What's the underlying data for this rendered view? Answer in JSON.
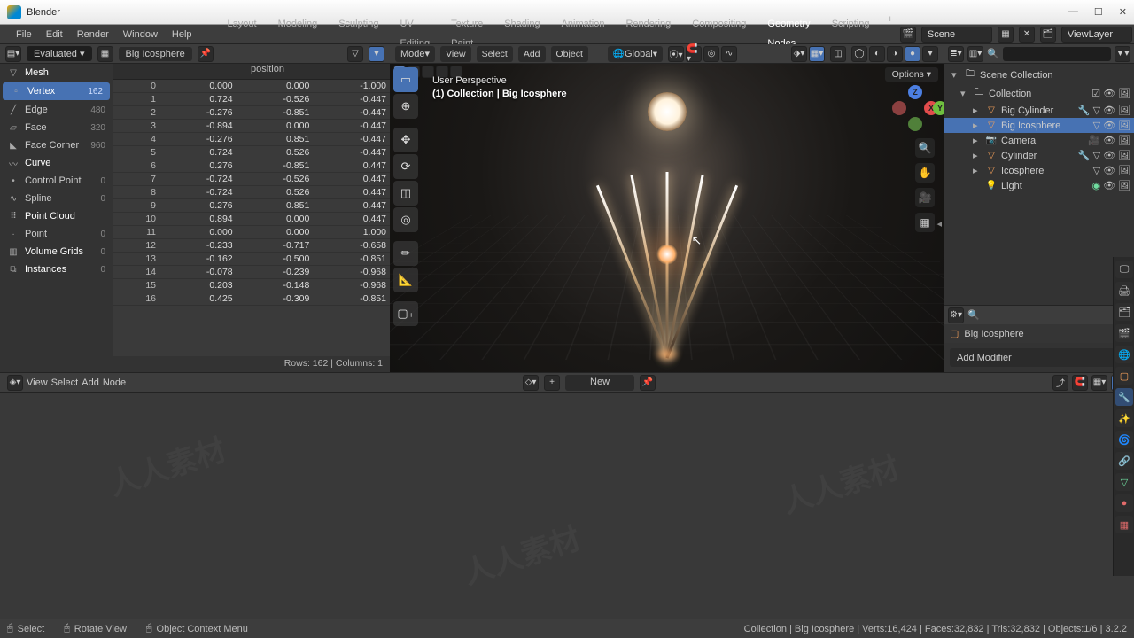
{
  "titlebar": {
    "app": "Blender"
  },
  "menu": {
    "file": "File",
    "edit": "Edit",
    "render": "Render",
    "window": "Window",
    "help": "Help"
  },
  "workspaces": {
    "layout": "Layout",
    "modeling": "Modeling",
    "sculpting": "Sculpting",
    "uv": "UV Editing",
    "texpaint": "Texture Paint",
    "shading": "Shading",
    "animation": "Animation",
    "rendering": "Rendering",
    "compositing": "Compositing",
    "geonodes": "Geometry Nodes",
    "scripting": "Scripting"
  },
  "scenebox": {
    "scene": "Scene",
    "viewlayer": "ViewLayer"
  },
  "spreadsheet": {
    "eval": "Evaluated",
    "pinned": "Big Icosphere",
    "domains": {
      "mesh": "Mesh",
      "vertex": "Vertex",
      "vertex_cnt": "162",
      "edge": "Edge",
      "edge_cnt": "480",
      "face": "Face",
      "face_cnt": "320",
      "facecorner": "Face Corner",
      "facecorner_cnt": "960",
      "curve": "Curve",
      "cp": "Control Point",
      "cp_cnt": "0",
      "spline": "Spline",
      "spline_cnt": "0",
      "pointcloud": "Point Cloud",
      "point": "Point",
      "point_cnt": "0",
      "volgrids": "Volume Grids",
      "volgrids_cnt": "0",
      "instances": "Instances",
      "instances_cnt": "0"
    },
    "col_header": "position",
    "rows": [
      {
        "i": 0,
        "x": "0.000",
        "y": "0.000",
        "z": "-1.000"
      },
      {
        "i": 1,
        "x": "0.724",
        "y": "-0.526",
        "z": "-0.447"
      },
      {
        "i": 2,
        "x": "-0.276",
        "y": "-0.851",
        "z": "-0.447"
      },
      {
        "i": 3,
        "x": "-0.894",
        "y": "0.000",
        "z": "-0.447"
      },
      {
        "i": 4,
        "x": "-0.276",
        "y": "0.851",
        "z": "-0.447"
      },
      {
        "i": 5,
        "x": "0.724",
        "y": "0.526",
        "z": "-0.447"
      },
      {
        "i": 6,
        "x": "0.276",
        "y": "-0.851",
        "z": "0.447"
      },
      {
        "i": 7,
        "x": "-0.724",
        "y": "-0.526",
        "z": "0.447"
      },
      {
        "i": 8,
        "x": "-0.724",
        "y": "0.526",
        "z": "0.447"
      },
      {
        "i": 9,
        "x": "0.276",
        "y": "0.851",
        "z": "0.447"
      },
      {
        "i": 10,
        "x": "0.894",
        "y": "0.000",
        "z": "0.447"
      },
      {
        "i": 11,
        "x": "0.000",
        "y": "0.000",
        "z": "1.000"
      },
      {
        "i": 12,
        "x": "-0.233",
        "y": "-0.717",
        "z": "-0.658"
      },
      {
        "i": 13,
        "x": "-0.162",
        "y": "-0.500",
        "z": "-0.851"
      },
      {
        "i": 14,
        "x": "-0.078",
        "y": "-0.239",
        "z": "-0.968"
      },
      {
        "i": 15,
        "x": "0.203",
        "y": "-0.148",
        "z": "-0.968"
      },
      {
        "i": 16,
        "x": "0.425",
        "y": "-0.309",
        "z": "-0.851"
      }
    ],
    "footer": "Rows: 162   |   Columns: 1"
  },
  "vp": {
    "mode": "Mode",
    "view": "View",
    "select": "Select",
    "add": "Add",
    "object": "Object",
    "orient": "Global",
    "options": "Options ▾",
    "hud1": "User Perspective",
    "hud2": "(1) Collection | Big Icosphere"
  },
  "outliner": {
    "root": "Scene Collection",
    "collection": "Collection",
    "bigcyl": "Big Cylinder",
    "bigico": "Big Icosphere",
    "camera": "Camera",
    "cylinder": "Cylinder",
    "icosphere": "Icosphere",
    "light": "Light"
  },
  "props": {
    "active": "Big Icosphere",
    "addmod": "Add Modifier"
  },
  "nodeeditor": {
    "view": "View",
    "select": "Select",
    "add": "Add",
    "node": "Node",
    "new": "New"
  },
  "status": {
    "select": "Select",
    "rotate": "Rotate View",
    "ctx": "Object Context Menu",
    "right": "Collection | Big Icosphere   |  Verts:16,424  |  Faces:32,832  |  Tris:32,832  |  Objects:1/6  |  3.2.2"
  },
  "icons": {
    "close": "✕",
    "min": "—",
    "max": "☐",
    "search": "🔍",
    "dd": "▾",
    "tri_r": "▸",
    "tri_d": "▾",
    "eye": "👁",
    "cam": "📷",
    "rndr": "🖼",
    "sel": "⌄",
    "mesh": "▽",
    "light": "💡",
    "coll": "📁",
    "pin": "📌",
    "cursor": "⊕",
    "move": "✥",
    "rot": "⟳",
    "scale": "◫",
    "xform": "◎",
    "meas": "📐",
    "anno": "✏",
    "zoom": "🔍",
    "hand": "✋",
    "persp": "▦",
    "camv": "🎥",
    "shade1": "◯",
    "shade2": "◐",
    "shade3": "◑",
    "shade4": "●",
    "wrench": "🔧",
    "particles": "✨",
    "physics": "🌐",
    "constraint": "🔗",
    "data": "▽",
    "mat": "●",
    "tex": "▦"
  }
}
